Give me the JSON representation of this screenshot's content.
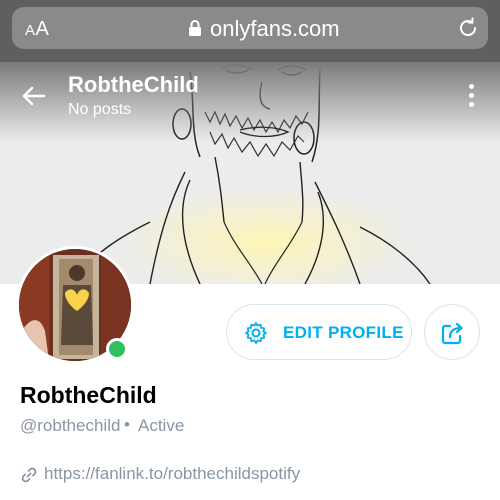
{
  "browser": {
    "text_size_label": "AA",
    "url": "onlyfans.com",
    "icons": {
      "lock": "lock-icon",
      "reload": "reload-icon"
    }
  },
  "header": {
    "name": "RobtheChild",
    "posts_label": "No posts",
    "icons": {
      "back": "back-arrow-icon",
      "more": "more-vertical-icon"
    }
  },
  "profile": {
    "display_name": "RobtheChild",
    "handle": "@robthechild",
    "separator": "•",
    "status": "Active",
    "online": true,
    "link": "https://fanlink.to/robthechildspotify"
  },
  "actions": {
    "edit_label": "EDIT PROFILE",
    "icons": {
      "edit": "gear-icon",
      "share": "share-icon"
    }
  },
  "colors": {
    "brand_blue": "#00aff0",
    "muted_text": "#8a96a3",
    "online_green": "#2ec15e",
    "browser_bar": "#5f5f5f"
  }
}
